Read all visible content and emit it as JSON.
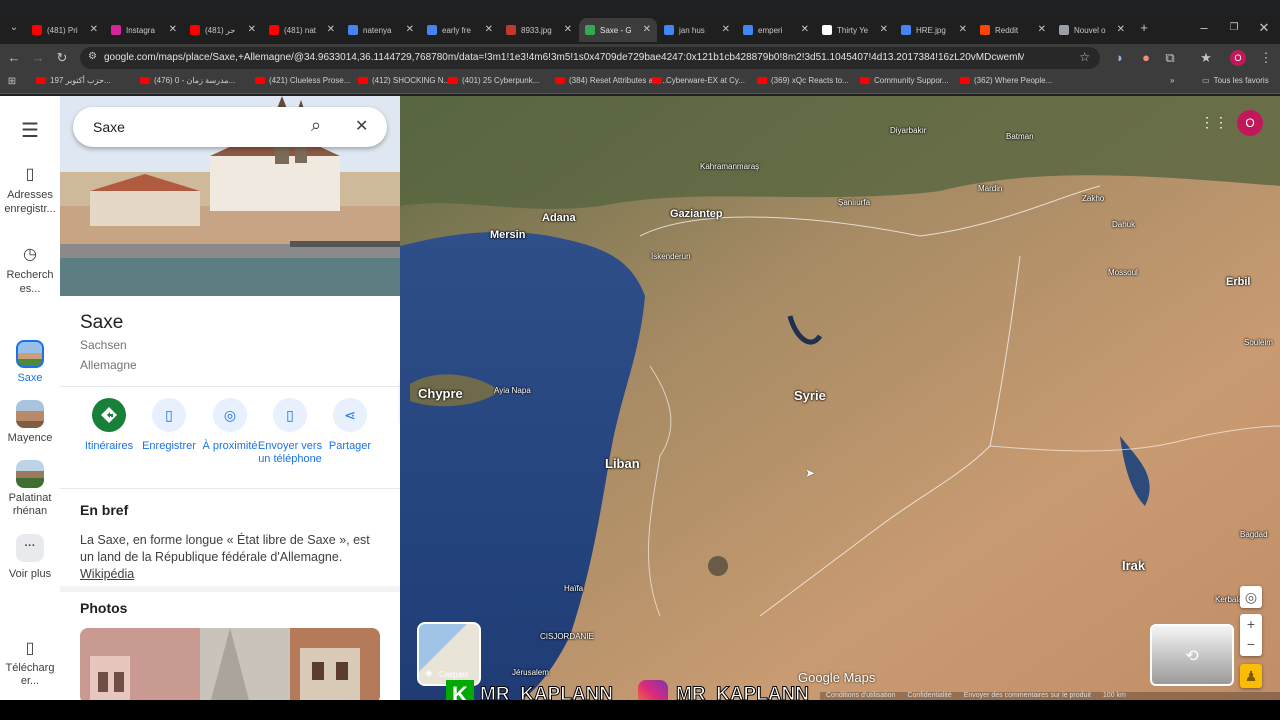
{
  "browser": {
    "tabs": [
      {
        "title": "(481) Pri",
        "icon_color": "#ff0000"
      },
      {
        "title": "Instagra",
        "icon_color": "#d6249f"
      },
      {
        "title": "(481) حر",
        "icon_color": "#ff0000"
      },
      {
        "title": "(481) nat",
        "icon_color": "#ff0000"
      },
      {
        "title": "natenya",
        "icon_color": "#4285f4"
      },
      {
        "title": "early fre",
        "icon_color": "#4285f4"
      },
      {
        "title": "8933.jpg",
        "icon_color": "#c0392b"
      },
      {
        "title": "Saxe - G",
        "icon_color": "#34a853"
      },
      {
        "title": "jan hus",
        "icon_color": "#4285f4"
      },
      {
        "title": "emperi",
        "icon_color": "#4285f4"
      },
      {
        "title": "Thirty Ye",
        "icon_color": "#ffffff"
      },
      {
        "title": "HRE.jpg",
        "icon_color": "#4285f4"
      },
      {
        "title": "Reddit",
        "icon_color": "#ff4500"
      },
      {
        "title": "Nouvel o",
        "icon_color": "#9aa0a6"
      }
    ],
    "active_tab_index": 7,
    "url": "google.com/maps/place/Saxe,+Allemagne/@34.9633014,36.1144729,768780m/data=!3m1!1e3!4m6!3m5!1s0x4709de729bae4247:0x121b1cb428879b0!8m2!3d51.1045407!4d13.2017384!16zL20vMDcwemM?entry=ttu&g_ep...",
    "bookmarks": [
      "حزب أكتوبر 197...",
      "(476) مدرسة زمان - 0...",
      "(421) Clueless Prose...",
      "(412) SHOCKING N...",
      "(401) 25 Cyberpunk...",
      "(384) Reset Attributes alw...",
      "Cyberware-EX at Cy...",
      "(369) xQc Reacts to...",
      "Community Suppor...",
      "(362) Where People..."
    ],
    "all_bookmarks_label": "Tous les favoris",
    "profile_initial": "O"
  },
  "rail": {
    "menu_icon": "hamburger-icon",
    "saved_label": "Adresses enregistr...",
    "recents_label": "Recherch es...",
    "items": [
      {
        "label": "Saxe"
      },
      {
        "label": "Mayence"
      },
      {
        "label": "Palatinat rhénan"
      }
    ],
    "more_label": "Voir plus",
    "download_label": "Télécharg er..."
  },
  "search": {
    "value": "Saxe"
  },
  "place": {
    "name": "Saxe",
    "native_name": "Sachsen",
    "country": "Allemagne",
    "actions": [
      "Itinéraires",
      "Enregistrer",
      "À proximité",
      "Envoyer vers un téléphone",
      "Partager"
    ],
    "overview_title": "En bref",
    "overview_text": "La Saxe, en forme longue « État libre de Saxe », est un land de la République fédérale d'Allemagne.",
    "overview_link": "Wikipédia",
    "photos_title": "Photos"
  },
  "map": {
    "labels": [
      {
        "text": "Diyarbakır"
      },
      {
        "text": "Batman"
      },
      {
        "text": "Kahramanmaraş"
      },
      {
        "text": "Şanlıurfa"
      },
      {
        "text": "Mardin"
      },
      {
        "text": "Zakho"
      },
      {
        "text": "Dahuk"
      },
      {
        "text": "Adana"
      },
      {
        "text": "Gaziantep"
      },
      {
        "text": "Mersin"
      },
      {
        "text": "İskenderun"
      },
      {
        "text": "Mossoul"
      },
      {
        "text": "Erbil"
      },
      {
        "text": "Souleim"
      },
      {
        "text": "Chypre"
      },
      {
        "text": "Ayia Napa"
      },
      {
        "text": "Syrie"
      },
      {
        "text": "Liban"
      },
      {
        "text": "Irak"
      },
      {
        "text": "Bagdad"
      },
      {
        "text": "Haïfa"
      },
      {
        "text": "CISJORDANIE"
      },
      {
        "text": "Jérusalem"
      },
      {
        "text": "Kerbala"
      }
    ],
    "layers_label": "Calques",
    "footer_links": [
      "Conditions d'utilisation",
      "Confidentialité",
      "Envoyer des commentaires sur le produit"
    ],
    "scale": "100 km",
    "brand": "Google Maps"
  },
  "overlay": {
    "handle_1": "MR_KAPLANN",
    "handle_2": "MR_KAPLANN"
  }
}
